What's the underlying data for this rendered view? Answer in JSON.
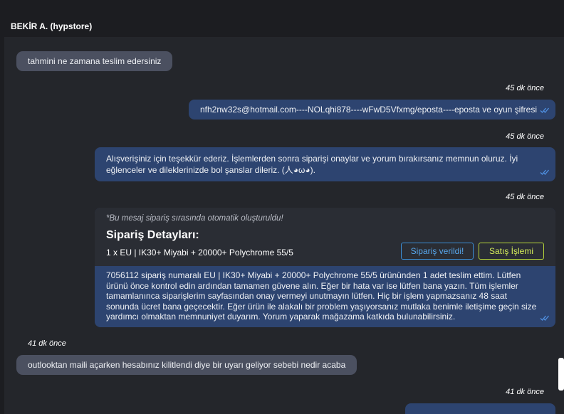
{
  "header": {
    "contact_name": "BEKİR A. (hypstore)"
  },
  "messages": {
    "m1": {
      "text": "tahmini ne zamana teslim edersiniz"
    },
    "m2": {
      "time": "45 dk önce",
      "text": "nfh2nw32s@hotmail.com----NOLqhi878----wFwD5Vfxmg/eposta----eposta ve oyun şifresi"
    },
    "m3": {
      "time": "45 dk önce",
      "text": "Alışverişiniz için teşekkür ederiz. İşlemlerden sonra siparişi onaylar ve yorum bırakırsanız memnun oluruz. İyi eğlenceler ve dileklerinizde bol şanslar dileriz. (人◕ω◕)."
    },
    "m4": {
      "time": "45 dk önce",
      "auto_note": "*Bu mesaj sipariş sırasında otomatik oluşturuldu!",
      "title": "Sipariş Detayları:",
      "item": "1 x EU | IK30+ Miyabi + 20000+ Polychrome 55/5",
      "status_button": "Sipariş verildi!",
      "sale_button": "Satış İşlemi",
      "body": "7056112 sipariş numaralı EU | IK30+ Miyabi + 20000+ Polychrome 55/5 ürününden 1 adet teslim ettim. Lütfen ürünü önce kontrol edin ardından tamamen güvene alın. Eğer bir hata var ise lütfen bana yazın. Tüm işlemler tamamlanınca siparişlerim sayfasından onay vermeyi unutmayın lütfen. Hiç bir işlem yapmazsanız 48 saat sonunda ücret bana geçecektir. Eğer ürün ile alakalı bir problem yaşıyorsanız mutlaka benimle iletişime geçin size yardımcı olmaktan memnuniyet duyarım. Yorum yaparak mağazama katkıda bulunabilirsiniz."
    },
    "m5": {
      "time": "41 dk önce",
      "text": "outlooktan maili açarken hesabınız kilitlendi diye bir uyarı geliyor sebebi nedir acaba"
    },
    "m6": {
      "time": "41 dk önce",
      "text": ""
    }
  },
  "icons": {
    "read_receipt": "double-check-icon"
  },
  "colors": {
    "background": "#1c1d21",
    "chat_area": "#24262b",
    "incoming_bubble": "#4b5060",
    "outgoing_bubble": "#2d4470",
    "read_check": "#4f8fe0",
    "status_button": "#3b8fd6",
    "sale_button": "#b7d63a"
  }
}
